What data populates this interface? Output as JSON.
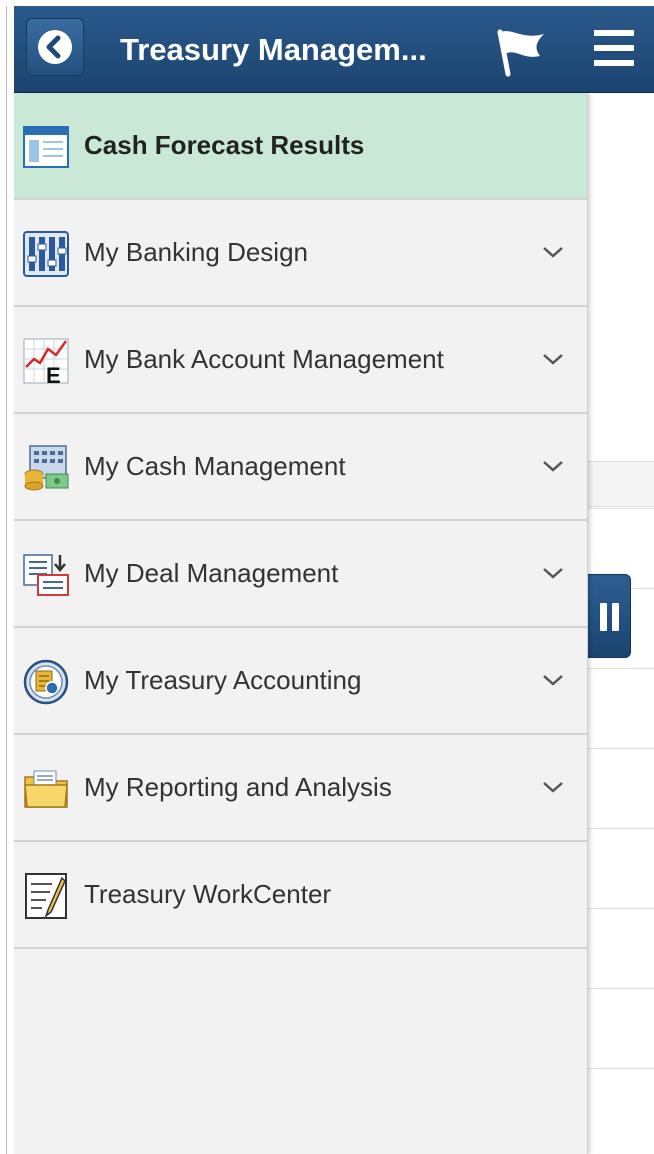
{
  "header": {
    "title": "Treasury Managem...",
    "back_icon": "chevron-left-icon",
    "flag_icon": "flag-icon",
    "menu_icon": "hamburger-icon",
    "background_color": "#1f4a78"
  },
  "menu": {
    "items": [
      {
        "label": "Cash Forecast Results",
        "icon": "page-layout-icon",
        "selected": true,
        "expandable": false
      },
      {
        "label": "My Banking Design",
        "icon": "sliders-icon",
        "selected": false,
        "expandable": true
      },
      {
        "label": "My Bank Account Management",
        "icon": "chart-e-icon",
        "selected": false,
        "expandable": true
      },
      {
        "label": "My Cash Management",
        "icon": "cash-calculator-icon",
        "selected": false,
        "expandable": true
      },
      {
        "label": "My Deal Management",
        "icon": "deal-forms-icon",
        "selected": false,
        "expandable": true
      },
      {
        "label": "My Treasury Accounting",
        "icon": "accounting-globe-icon",
        "selected": false,
        "expandable": true
      },
      {
        "label": "My Reporting and Analysis",
        "icon": "folder-icon",
        "selected": false,
        "expandable": true
      },
      {
        "label": "Treasury WorkCenter",
        "icon": "workcenter-notepad-icon",
        "selected": false,
        "expandable": false
      }
    ],
    "selected_color": "#c9e9d6"
  },
  "side_handle": {
    "icon": "pause-icon"
  }
}
